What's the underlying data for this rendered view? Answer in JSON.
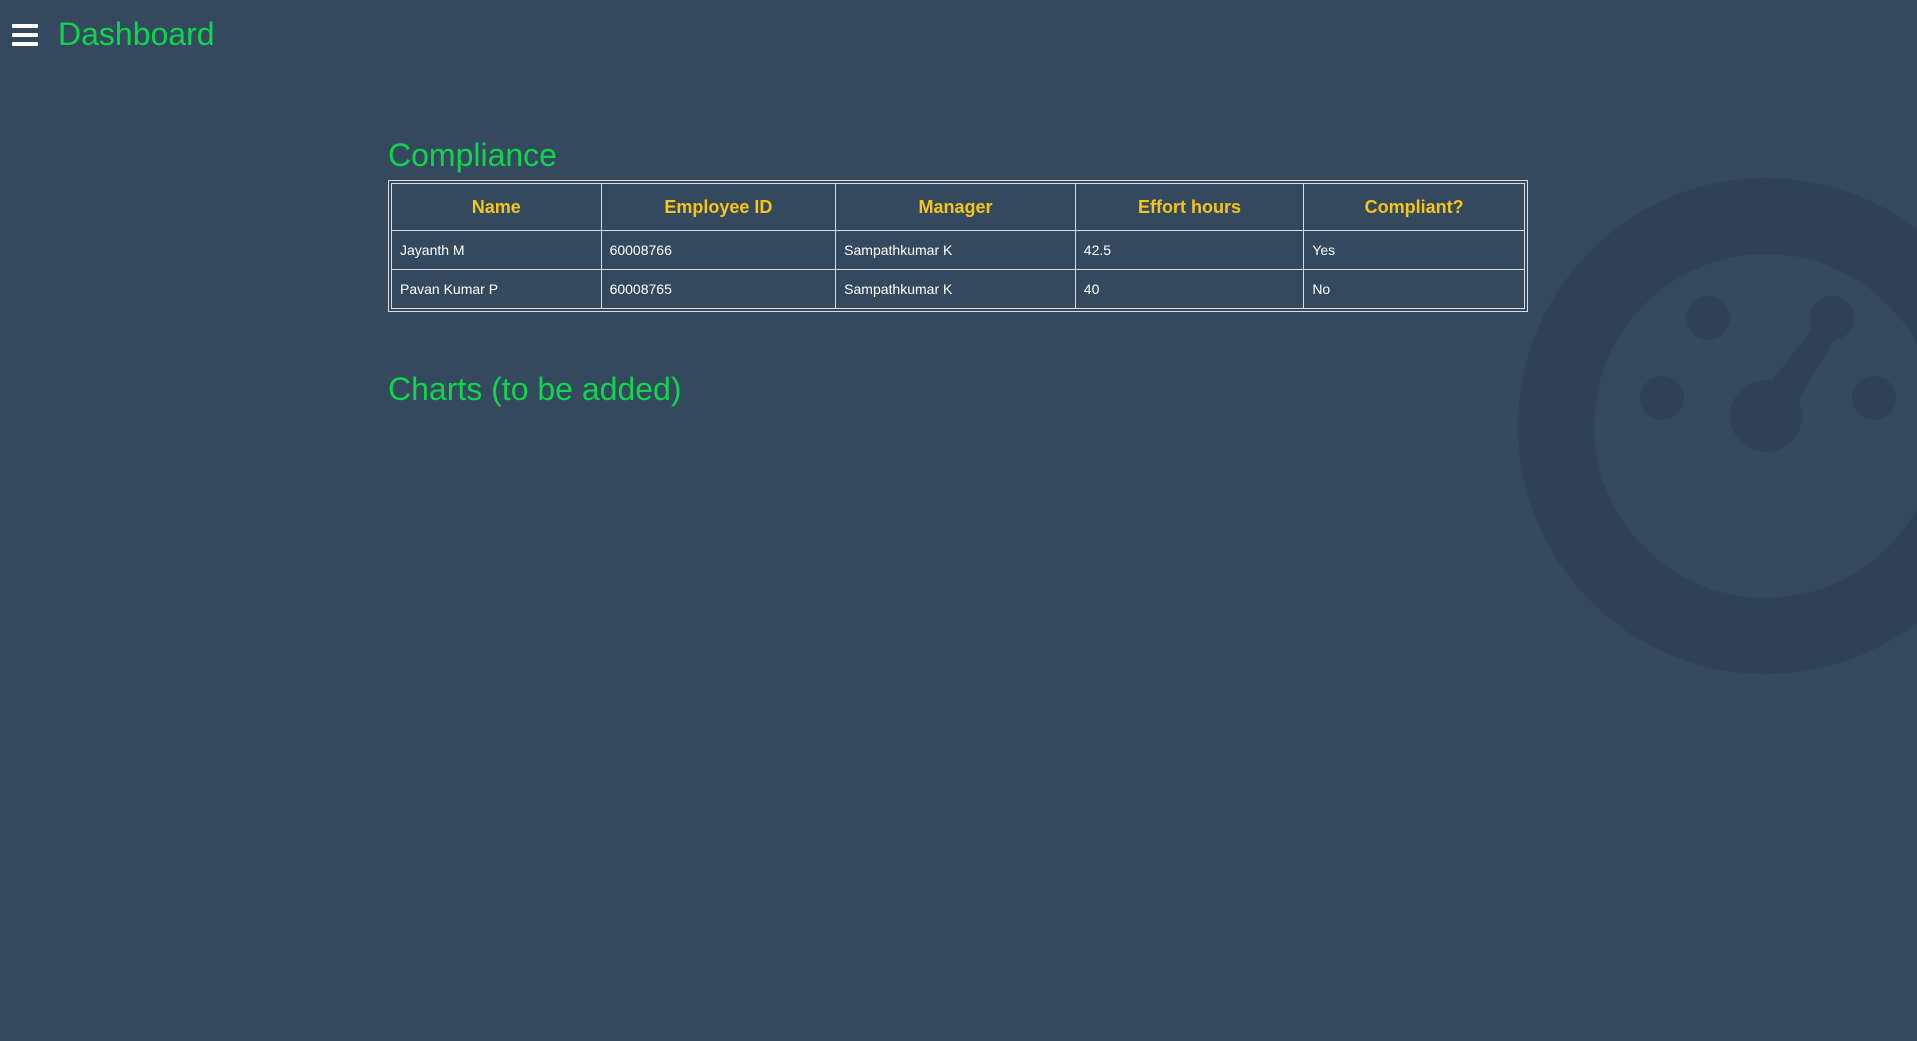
{
  "header": {
    "title": "Dashboard",
    "menu_icon": "hamburger-menu-icon"
  },
  "compliance": {
    "title": "Compliance",
    "columns": [
      "Name",
      "Employee ID",
      "Manager",
      "Effort hours",
      "Compliant?"
    ],
    "rows": [
      [
        "Jayanth M",
        "60008766",
        "Sampathkumar K",
        "42.5",
        "Yes"
      ],
      [
        "Pavan Kumar P",
        "60008765",
        "Sampathkumar K",
        "40",
        "No"
      ]
    ]
  },
  "charts": {
    "title": "Charts (to be added)"
  },
  "watermark": {
    "icon": "dashboard-gauge-icon"
  },
  "colors": {
    "background": "#34495e",
    "title_green": "#0fd44c",
    "header_yellow": "#f5c518",
    "watermark": "#2f4257"
  }
}
